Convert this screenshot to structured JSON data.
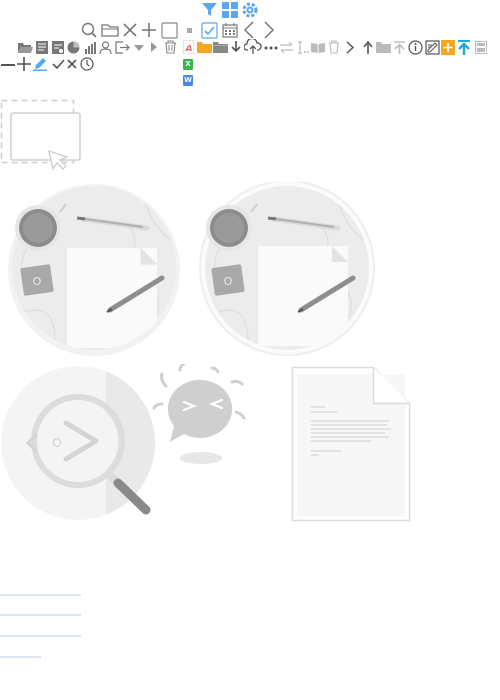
{
  "badges": {
    "excel": "X",
    "word": "W"
  },
  "illustrations": {
    "search_face": "O",
    "note_card": "O"
  },
  "icons": [
    "filter-icon",
    "grid-icon",
    "gear-icon",
    "search-icon",
    "folder-icon",
    "close-icon",
    "plus-icon",
    "checkbox-icon",
    "checkbox-checked-icon",
    "calendar-icon",
    "chevron-left-icon",
    "chevron-right-icon",
    "folder-open-icon",
    "document-icon",
    "chart-bar-icon",
    "pie-chart-icon",
    "user-icon",
    "export-icon",
    "caret-down-icon",
    "caret-right-icon",
    "trash-icon",
    "pdf-icon",
    "upload-cloud-icon",
    "more-icon",
    "transfer-icon",
    "book-icon",
    "arrow-up-icon",
    "info-icon",
    "edit-icon",
    "add-orange-icon",
    "upload-blue-icon",
    "minus-icon",
    "pencil-icon",
    "check-icon",
    "clock-icon",
    "excel-icon",
    "word-icon"
  ],
  "colors": {
    "blue": "#5aa7f0",
    "gray": "#8a8a8a",
    "orange": "#f5a623",
    "green": "#39b54a",
    "wordblue": "#4a86e8",
    "red": "#e25b4b"
  }
}
